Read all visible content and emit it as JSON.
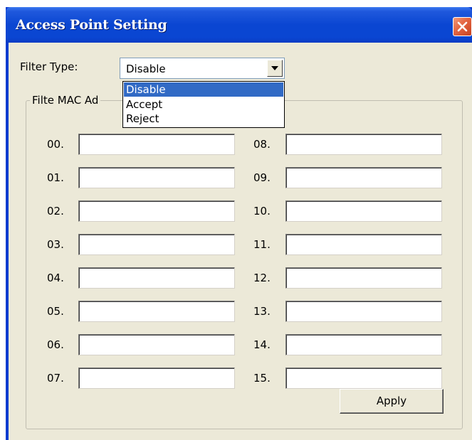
{
  "window": {
    "title": "Access Point Setting"
  },
  "filter": {
    "label": "Filter Type:",
    "selected": "Disable",
    "options": [
      "Disable",
      "Accept",
      "Reject"
    ]
  },
  "mac_group": {
    "legend": "Filte MAC Ad",
    "left_labels": [
      "00.",
      "01.",
      "02.",
      "03.",
      "04.",
      "05.",
      "06.",
      "07."
    ],
    "right_labels": [
      "08.",
      "09.",
      "10.",
      "11.",
      "12.",
      "13.",
      "14.",
      "15."
    ],
    "values": [
      "",
      "",
      "",
      "",
      "",
      "",
      "",
      "",
      "",
      "",
      "",
      "",
      "",
      "",
      "",
      ""
    ]
  },
  "apply_label": "Apply",
  "colors": {
    "titlebar": "#0a46d2",
    "client": "#ece9d8",
    "close_button": "#e36441",
    "selection": "#316ac5"
  },
  "icons": {
    "close": "close-icon",
    "dropdown": "chevron-down-icon"
  }
}
